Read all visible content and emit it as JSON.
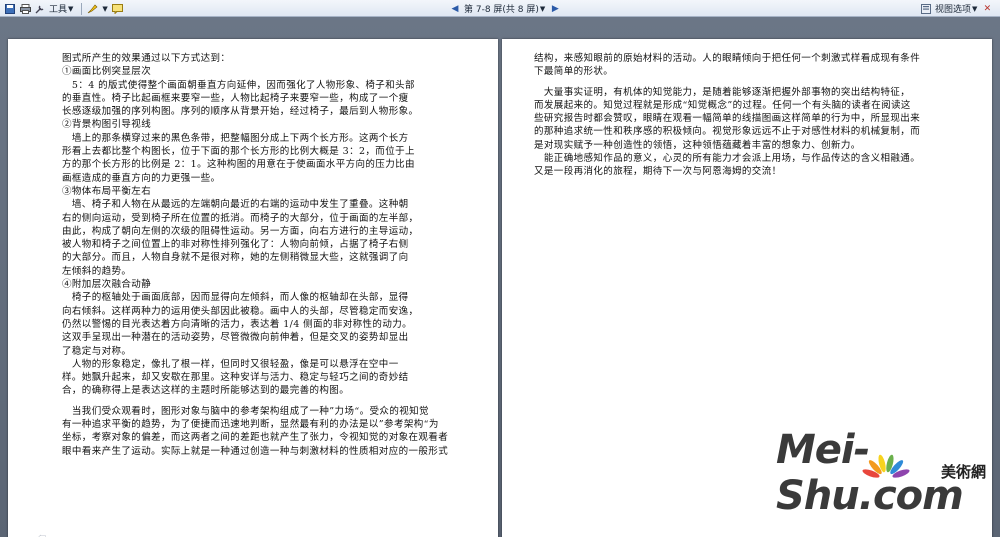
{
  "toolbar": {
    "tools_label": "工具",
    "page_nav_label": "第 7-8 屏(共 8 屏)",
    "view_options_label": "视图选项"
  },
  "left_page": {
    "lines": [
      "图式所产生的效果通过以下方式达到：",
      "①画面比例突显层次",
      "　5：4 的版式使得整个画面朝垂直方向延伸，因而强化了人物形象、椅子和头部",
      "的垂直性。椅子比起画框来要窄一些，人物比起椅子来要窄一些，构成了一个瘦",
      "长感逐级加强的序列构图。序列的顺序从背景开始，经过椅子，最后到人物形象。",
      "②背景构图引导视线",
      "　墙上的那条横穿过来的黑色条带，把整幅图分成上下两个长方形。这两个长方",
      "形看上去都比整个构图长，位于下面的那个长方形的比例大概是 3：2，而位于上",
      "方的那个长方形的比例是 2：1。这种构图的用意在于使画面水平方向的压力比由",
      "画框造成的垂直方向的力更强一些。",
      "③物体布局平衡左右",
      "　墙、椅子和人物在从最远的左端朝向最近的右端的运动中发生了重叠。这种朝",
      "右的侧向运动，受到椅子所在位置的抵消。而椅子的大部分，位于画面的左半部，",
      "由此，构成了朝向左侧的次级的阻碍性运动。另一方面，向右方进行的主导运动，",
      "被人物和椅子之间位置上的非对称性排列强化了：人物向前倾，占据了椅子右侧",
      "的大部分。而且，人物自身就不是很对称，她的左侧稍微显大些，这就强调了向",
      "左倾斜的趋势。",
      "④附加层次融合动静",
      "　椅子的枢轴处于画面底部，因而显得向左倾斜，而人像的枢轴却在头部，显得",
      "向右倾斜。这样两种力的运用使头部因此被稳。画中人的头部，尽管稳定而安逸，",
      "仍然以警惕的目光表达着方向清晰的活力，表达着 1/4 侧面的非对称性的动力。",
      "这双手呈现出一种潜在的活动姿势，尽管微微向前伸着，但是交叉的姿势却显出",
      "了稳定与对称。",
      "　人物的形象稳定，像扎了根一样，但同时又很轻盈，像是可以悬浮在空中一",
      "样。她飘升起来，却又安歇在那里。这种安详与活力、稳定与轻巧之间的奇妙结",
      "合，的确称得上是表达这样的主题时所能够达到的最完善的构图。",
      "　当我们受众观看时，图形对象与脑中的参考架构组成了一种”力场“。受众的视知觉",
      "有一种追求平衡的趋势，为了便捷而迅速地判断，显然最有利的办法是以”参考架构“为",
      "坐标，考察对象的偏差，而这两者之间的差距也就产生了张力，令视知觉的对象在观看者",
      "眼中看来产生了运动。实际上就是一种通过创造一种与刺激材料的性质相对应的一般形式"
    ]
  },
  "right_page": {
    "lines": [
      "结构，来感知眼前的原始材料的活动。人的眼睛倾向于把任何一个刺激式样看成现有条件",
      "下最简单的形状。",
      "　大量事实证明，有机体的知觉能力，是随着能够逐渐把握外部事物的突出结构特征，",
      "而发展起来的。知觉过程就是形成“知觉概念”的过程。任何一个有头脑的读者在阅读这",
      "些研究报告时都会赞叹，眼睛在观看一幅简单的线描图画这样简单的行为中，所显现出来",
      "的那种追求统一性和秩序感的积极倾向。视觉形象远远不止于对感性材料的机械复制，而",
      "是对现实赋予一种创造性的领悟，这种领悟蕴藏着丰富的想象力、创新力。",
      "　能正确地感知作品的意义，心灵的所有能力才会派上用场，与作品传达的含义相融通。",
      "又是一段再消化的旅程，期待下一次与阿恩海姆的交流！"
    ]
  },
  "watermark": {
    "latin": "Mei-Shu.com",
    "chinese": "美術網"
  },
  "colors": {
    "workspace": "#5f6a7a",
    "toolbar": "#dfe7f2",
    "page": "#ffffff",
    "watermark_flower": [
      "#e8463c",
      "#f39a1e",
      "#f7d31f",
      "#6ab04c",
      "#2e8bd8",
      "#8e44ad"
    ]
  }
}
